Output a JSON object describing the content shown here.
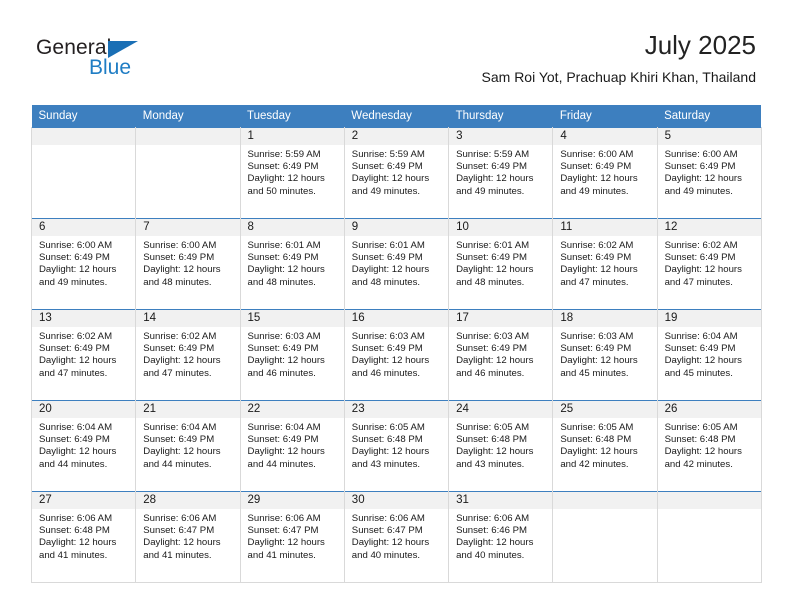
{
  "brand": {
    "name_part1": "General",
    "name_part2": "Blue",
    "logo_icon": "triangle-icon",
    "accent_color": "#1a6fb5"
  },
  "header": {
    "title": "July 2025",
    "subtitle": "Sam Roi Yot, Prachuap Khiri Khan, Thailand"
  },
  "calendar": {
    "header_bg": "#3d7fbf",
    "datebar_bg": "#f1f1f1",
    "weekday_headers": [
      "Sunday",
      "Monday",
      "Tuesday",
      "Wednesday",
      "Thursday",
      "Friday",
      "Saturday"
    ],
    "weeks": [
      [
        {
          "day": ""
        },
        {
          "day": ""
        },
        {
          "day": "1",
          "sunrise": "Sunrise: 5:59 AM",
          "sunset": "Sunset: 6:49 PM",
          "daylight1": "Daylight: 12 hours",
          "daylight2": "and 50 minutes."
        },
        {
          "day": "2",
          "sunrise": "Sunrise: 5:59 AM",
          "sunset": "Sunset: 6:49 PM",
          "daylight1": "Daylight: 12 hours",
          "daylight2": "and 49 minutes."
        },
        {
          "day": "3",
          "sunrise": "Sunrise: 5:59 AM",
          "sunset": "Sunset: 6:49 PM",
          "daylight1": "Daylight: 12 hours",
          "daylight2": "and 49 minutes."
        },
        {
          "day": "4",
          "sunrise": "Sunrise: 6:00 AM",
          "sunset": "Sunset: 6:49 PM",
          "daylight1": "Daylight: 12 hours",
          "daylight2": "and 49 minutes."
        },
        {
          "day": "5",
          "sunrise": "Sunrise: 6:00 AM",
          "sunset": "Sunset: 6:49 PM",
          "daylight1": "Daylight: 12 hours",
          "daylight2": "and 49 minutes."
        }
      ],
      [
        {
          "day": "6",
          "sunrise": "Sunrise: 6:00 AM",
          "sunset": "Sunset: 6:49 PM",
          "daylight1": "Daylight: 12 hours",
          "daylight2": "and 49 minutes."
        },
        {
          "day": "7",
          "sunrise": "Sunrise: 6:00 AM",
          "sunset": "Sunset: 6:49 PM",
          "daylight1": "Daylight: 12 hours",
          "daylight2": "and 48 minutes."
        },
        {
          "day": "8",
          "sunrise": "Sunrise: 6:01 AM",
          "sunset": "Sunset: 6:49 PM",
          "daylight1": "Daylight: 12 hours",
          "daylight2": "and 48 minutes."
        },
        {
          "day": "9",
          "sunrise": "Sunrise: 6:01 AM",
          "sunset": "Sunset: 6:49 PM",
          "daylight1": "Daylight: 12 hours",
          "daylight2": "and 48 minutes."
        },
        {
          "day": "10",
          "sunrise": "Sunrise: 6:01 AM",
          "sunset": "Sunset: 6:49 PM",
          "daylight1": "Daylight: 12 hours",
          "daylight2": "and 48 minutes."
        },
        {
          "day": "11",
          "sunrise": "Sunrise: 6:02 AM",
          "sunset": "Sunset: 6:49 PM",
          "daylight1": "Daylight: 12 hours",
          "daylight2": "and 47 minutes."
        },
        {
          "day": "12",
          "sunrise": "Sunrise: 6:02 AM",
          "sunset": "Sunset: 6:49 PM",
          "daylight1": "Daylight: 12 hours",
          "daylight2": "and 47 minutes."
        }
      ],
      [
        {
          "day": "13",
          "sunrise": "Sunrise: 6:02 AM",
          "sunset": "Sunset: 6:49 PM",
          "daylight1": "Daylight: 12 hours",
          "daylight2": "and 47 minutes."
        },
        {
          "day": "14",
          "sunrise": "Sunrise: 6:02 AM",
          "sunset": "Sunset: 6:49 PM",
          "daylight1": "Daylight: 12 hours",
          "daylight2": "and 47 minutes."
        },
        {
          "day": "15",
          "sunrise": "Sunrise: 6:03 AM",
          "sunset": "Sunset: 6:49 PM",
          "daylight1": "Daylight: 12 hours",
          "daylight2": "and 46 minutes."
        },
        {
          "day": "16",
          "sunrise": "Sunrise: 6:03 AM",
          "sunset": "Sunset: 6:49 PM",
          "daylight1": "Daylight: 12 hours",
          "daylight2": "and 46 minutes."
        },
        {
          "day": "17",
          "sunrise": "Sunrise: 6:03 AM",
          "sunset": "Sunset: 6:49 PM",
          "daylight1": "Daylight: 12 hours",
          "daylight2": "and 46 minutes."
        },
        {
          "day": "18",
          "sunrise": "Sunrise: 6:03 AM",
          "sunset": "Sunset: 6:49 PM",
          "daylight1": "Daylight: 12 hours",
          "daylight2": "and 45 minutes."
        },
        {
          "day": "19",
          "sunrise": "Sunrise: 6:04 AM",
          "sunset": "Sunset: 6:49 PM",
          "daylight1": "Daylight: 12 hours",
          "daylight2": "and 45 minutes."
        }
      ],
      [
        {
          "day": "20",
          "sunrise": "Sunrise: 6:04 AM",
          "sunset": "Sunset: 6:49 PM",
          "daylight1": "Daylight: 12 hours",
          "daylight2": "and 44 minutes."
        },
        {
          "day": "21",
          "sunrise": "Sunrise: 6:04 AM",
          "sunset": "Sunset: 6:49 PM",
          "daylight1": "Daylight: 12 hours",
          "daylight2": "and 44 minutes."
        },
        {
          "day": "22",
          "sunrise": "Sunrise: 6:04 AM",
          "sunset": "Sunset: 6:49 PM",
          "daylight1": "Daylight: 12 hours",
          "daylight2": "and 44 minutes."
        },
        {
          "day": "23",
          "sunrise": "Sunrise: 6:05 AM",
          "sunset": "Sunset: 6:48 PM",
          "daylight1": "Daylight: 12 hours",
          "daylight2": "and 43 minutes."
        },
        {
          "day": "24",
          "sunrise": "Sunrise: 6:05 AM",
          "sunset": "Sunset: 6:48 PM",
          "daylight1": "Daylight: 12 hours",
          "daylight2": "and 43 minutes."
        },
        {
          "day": "25",
          "sunrise": "Sunrise: 6:05 AM",
          "sunset": "Sunset: 6:48 PM",
          "daylight1": "Daylight: 12 hours",
          "daylight2": "and 42 minutes."
        },
        {
          "day": "26",
          "sunrise": "Sunrise: 6:05 AM",
          "sunset": "Sunset: 6:48 PM",
          "daylight1": "Daylight: 12 hours",
          "daylight2": "and 42 minutes."
        }
      ],
      [
        {
          "day": "27",
          "sunrise": "Sunrise: 6:06 AM",
          "sunset": "Sunset: 6:48 PM",
          "daylight1": "Daylight: 12 hours",
          "daylight2": "and 41 minutes."
        },
        {
          "day": "28",
          "sunrise": "Sunrise: 6:06 AM",
          "sunset": "Sunset: 6:47 PM",
          "daylight1": "Daylight: 12 hours",
          "daylight2": "and 41 minutes."
        },
        {
          "day": "29",
          "sunrise": "Sunrise: 6:06 AM",
          "sunset": "Sunset: 6:47 PM",
          "daylight1": "Daylight: 12 hours",
          "daylight2": "and 41 minutes."
        },
        {
          "day": "30",
          "sunrise": "Sunrise: 6:06 AM",
          "sunset": "Sunset: 6:47 PM",
          "daylight1": "Daylight: 12 hours",
          "daylight2": "and 40 minutes."
        },
        {
          "day": "31",
          "sunrise": "Sunrise: 6:06 AM",
          "sunset": "Sunset: 6:46 PM",
          "daylight1": "Daylight: 12 hours",
          "daylight2": "and 40 minutes."
        },
        {
          "day": ""
        },
        {
          "day": ""
        }
      ]
    ]
  }
}
